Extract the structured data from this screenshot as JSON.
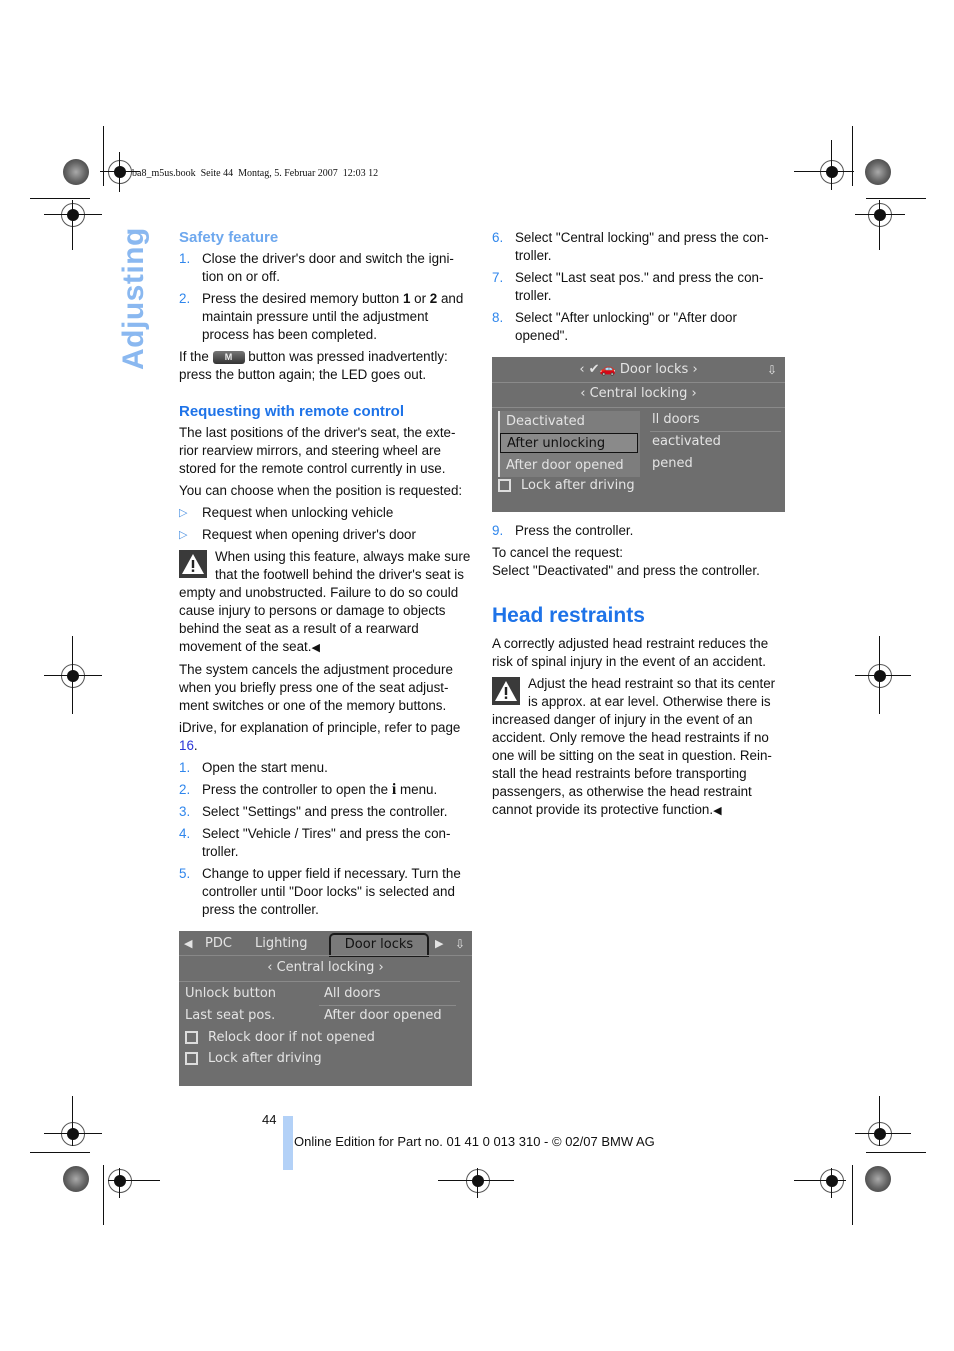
{
  "print_header": "ba8_m5us.book  Seite 44  Montag, 5. Februar 2007  12:03 12",
  "side_tab": "Adjusting",
  "left_column": {
    "safety": {
      "heading": "Safety feature",
      "steps": [
        {
          "num": "1.",
          "text": "Close the driver's door and switch the igni-tion on or off."
        },
        {
          "num": "2.",
          "text_before": "Press the desired memory button ",
          "bold1": "1",
          "mid": " or ",
          "bold2": "2",
          "text_after": " and maintain pressure until the adjustment process has been completed."
        }
      ],
      "note_before": "If the",
      "button_label": "M",
      "note_after": "button was pressed inadvertently: press the button again; the LED goes out."
    },
    "remote": {
      "heading": "Requesting with remote control",
      "para1": "The last positions of the driver's seat, the exte-rior rearview mirrors, and steering wheel are stored for the remote control currently in use.",
      "para2": "You can choose when the position is requested:",
      "bullets": [
        "Request when unlocking vehicle",
        "Request when opening driver's door"
      ],
      "warning": "When using this feature, always make sure that the footwell behind the driver's seat is empty and unobstructed. Failure to do so could cause injury to persons or damage to objects behind the seat as a result of a rearward movement of the seat.",
      "para3": "The system cancels the adjustment procedure when you briefly press one of the seat adjust-ment switches or one of the memory buttons.",
      "para4_before": "iDrive, for explanation of principle, refer to page ",
      "para4_link": "16",
      "para4_after": ".",
      "steps": [
        {
          "num": "1.",
          "text": "Open the start menu."
        },
        {
          "num": "2.",
          "text_before": "Press the controller to open the ",
          "icon": "i",
          "text_after": " menu."
        },
        {
          "num": "3.",
          "text": "Select \"Settings\" and press the controller."
        },
        {
          "num": "4.",
          "text": "Select \"Vehicle / Tires\" and press the con-troller."
        },
        {
          "num": "5.",
          "text": "Change to upper field if necessary. Turn the controller until \"Door locks\" is selected and press the controller."
        }
      ]
    },
    "screen1": {
      "tabs": [
        "PDC",
        "Lighting",
        "Door locks"
      ],
      "selected_tab": "Door locks",
      "subtitle": "Central locking",
      "rows": [
        {
          "label": "Unlock button",
          "value": "All doors"
        },
        {
          "label": "Last seat pos.",
          "value": "After door opened"
        }
      ],
      "checkboxes": [
        "Relock door if not opened",
        "Lock after driving"
      ]
    }
  },
  "right_column": {
    "steps": [
      {
        "num": "6.",
        "text": "Select \"Central locking\" and press the con-troller."
      },
      {
        "num": "7.",
        "text": "Select \"Last seat pos.\" and press the con-troller."
      },
      {
        "num": "8.",
        "text": "Select \"After unlocking\" or \"After door opened\"."
      }
    ],
    "screen2": {
      "title": "Door locks",
      "subtitle": "Central locking",
      "options": [
        "Deactivated",
        "After unlocking",
        "After door opened"
      ],
      "selected_option": "After unlocking",
      "behind_values": [
        "ll doors",
        "eactivated",
        "pened"
      ],
      "checkbox": "Lock after driving"
    },
    "step9": {
      "num": "9.",
      "text": "Press the controller."
    },
    "cancel_line1": "To cancel the request:",
    "cancel_line2": "Select \"Deactivated\" and press the controller.",
    "head": {
      "heading": "Head restraints",
      "para": "A correctly adjusted head restraint reduces the risk of spinal injury in the event of an accident.",
      "warning": "Adjust the head restraint so that its center is approx. at ear level. Otherwise there is increased danger of injury in the event of an accident. Only remove the head restraints if no one will be sitting on the seat in question. Rein-stall the head restraints before transporting passengers, as otherwise the head restraint cannot provide its protective function."
    }
  },
  "footer": {
    "page_number": "44",
    "edition": "Online Edition for Part no. 01 41 0 013 310 - © 02/07 BMW AG",
    "accent_color": "#b3d1f7"
  }
}
